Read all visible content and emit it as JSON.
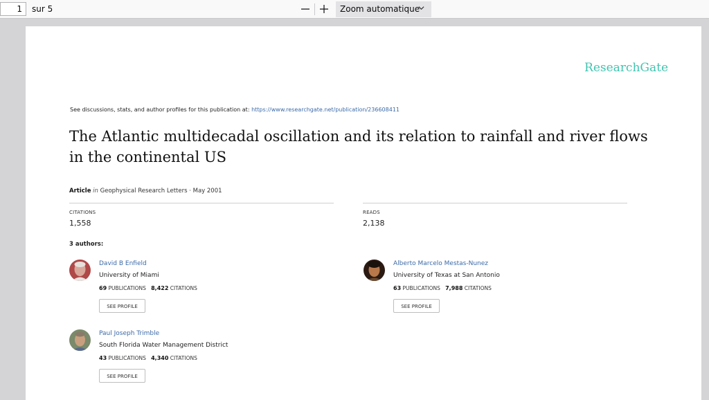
{
  "toolbar": {
    "page_number": "1",
    "page_count": "sur 5",
    "zoom_out_icon": "minus",
    "zoom_in_icon": "plus",
    "zoom_label": "Zoom automatique"
  },
  "document": {
    "brand": "ResearchGate",
    "see_text": "See discussions, stats, and author profiles for this publication at: ",
    "see_url": "https://www.researchgate.net/publication/236608411",
    "title": "The Atlantic multidecadal oscillation and its relation to rainfall and river flows in the continental US",
    "article_type": "Article",
    "in_word": "in",
    "journal_date": "Geophysical Research Letters · May 2001",
    "citations_label": "CITATIONS",
    "citations_value": "1,558",
    "reads_label": "READS",
    "reads_value": "2,138",
    "authors_heading": "3 authors:",
    "authors": [
      {
        "name": "David B Enfield",
        "institution": "University of Miami",
        "publications": "69",
        "publications_label": "PUBLICATIONS",
        "citations": "8,422",
        "citations_label": "CITATIONS",
        "button": "SEE PROFILE"
      },
      {
        "name": "Alberto Marcelo Mestas-Nunez",
        "institution": "University of Texas at San Antonio",
        "publications": "63",
        "publications_label": "PUBLICATIONS",
        "citations": "7,988",
        "citations_label": "CITATIONS",
        "button": "SEE PROFILE"
      },
      {
        "name": "Paul Joseph Trimble",
        "institution": "South Florida Water Management District",
        "publications": "43",
        "publications_label": "PUBLICATIONS",
        "citations": "4,340",
        "citations_label": "CITATIONS",
        "button": "SEE PROFILE"
      }
    ]
  },
  "colors": {
    "brand": "#40c4b0",
    "link": "#3b6aa8",
    "viewer_bg": "#d4d4d7"
  }
}
